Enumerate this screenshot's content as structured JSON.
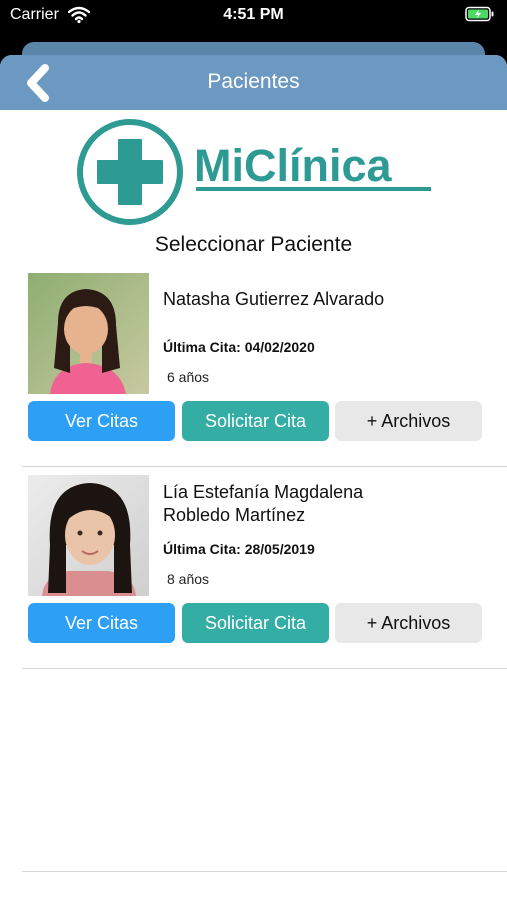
{
  "status_bar": {
    "carrier": "Carrier",
    "time": "4:51 PM",
    "wifi_icon": "wifi-icon",
    "battery_icon": "battery-charging-icon"
  },
  "nav": {
    "title": "Pacientes",
    "back_icon": "chevron-left-icon"
  },
  "logo": {
    "text": "MiClínica",
    "icon": "medical-cross-icon",
    "color": "#2e9a94"
  },
  "select_title": "Seleccionar Paciente",
  "colors": {
    "nav": "#6c99c1",
    "primary_button": "#2d9ff5",
    "secondary_button": "#34aea4",
    "neutral_button": "#e8e8e8"
  },
  "patients": [
    {
      "name": "Natasha Gutierrez Alvarado",
      "last_label": "Última Cita:",
      "last_date": "04/02/2020",
      "age": "6 años",
      "buttons": {
        "view": "Ver Citas",
        "request": "Solicitar Cita",
        "files": "+ Archivos"
      }
    },
    {
      "name": "Lía Estefanía Magdalena Robledo Martínez",
      "last_label": "Última Cita:",
      "last_date": "28/05/2019",
      "age": "8 años",
      "buttons": {
        "view": "Ver Citas",
        "request": "Solicitar Cita",
        "files": "+ Archivos"
      }
    }
  ]
}
